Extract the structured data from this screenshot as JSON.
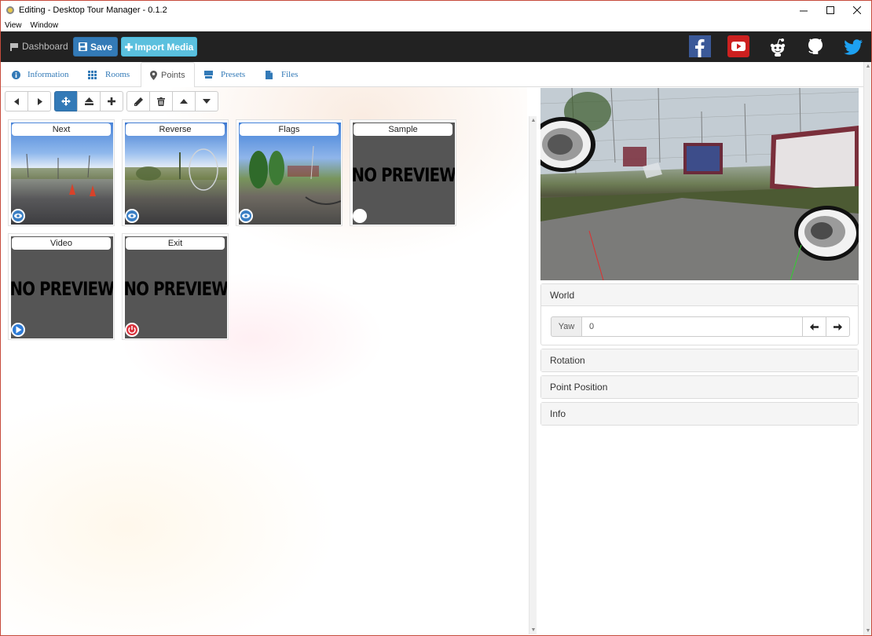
{
  "window": {
    "title": "Editing - Desktop Tour Manager - 0.1.2",
    "minimize_icon": "minimize-icon",
    "maximize_icon": "maximize-icon",
    "close_icon": "close-icon"
  },
  "menu": {
    "items": [
      "View",
      "Window"
    ]
  },
  "topnav": {
    "dashboard_label": "Dashboard",
    "save_label": "Save",
    "import_label": "Import Media",
    "social": [
      "facebook-icon",
      "youtube-icon",
      "reddit-icon",
      "github-icon",
      "twitter-icon"
    ],
    "colors": {
      "bar": "#222222",
      "save": "#337ab7",
      "import": "#5bc0de"
    }
  },
  "tabs": [
    {
      "label": "Information",
      "icon": "info-circle-icon"
    },
    {
      "label": "Rooms",
      "icon": "grid-icon"
    },
    {
      "label": "Points",
      "icon": "map-marker-icon",
      "active": true
    },
    {
      "label": "Presets",
      "icon": "preset-icon"
    },
    {
      "label": "Files",
      "icon": "file-icon"
    }
  ],
  "toolbar": {
    "buttons": [
      "prev-icon",
      "next-icon",
      "move-icon",
      "eject-icon",
      "add-icon",
      "edit-icon",
      "delete-icon",
      "up-icon",
      "down-icon"
    ],
    "active": "move-icon"
  },
  "points": [
    {
      "label": "Next",
      "preview": "image",
      "badge": "eye-icon"
    },
    {
      "label": "Reverse",
      "preview": "image",
      "badge": "eye-icon"
    },
    {
      "label": "Flags",
      "preview": "image",
      "badge": "eye-icon"
    },
    {
      "label": "Sample",
      "preview_text": "NO PREVIEW",
      "badge": "circle-icon"
    },
    {
      "label": "Video",
      "preview_text": "NO PREVIEW",
      "badge": "play-icon"
    },
    {
      "label": "Exit",
      "preview_text": "NO PREVIEW",
      "badge": "power-icon"
    }
  ],
  "properties": {
    "world": {
      "title": "World",
      "yaw_label": "Yaw",
      "yaw_value": "0"
    },
    "rotation": {
      "title": "Rotation"
    },
    "point_position": {
      "title": "Point Position"
    },
    "info": {
      "title": "Info"
    }
  }
}
